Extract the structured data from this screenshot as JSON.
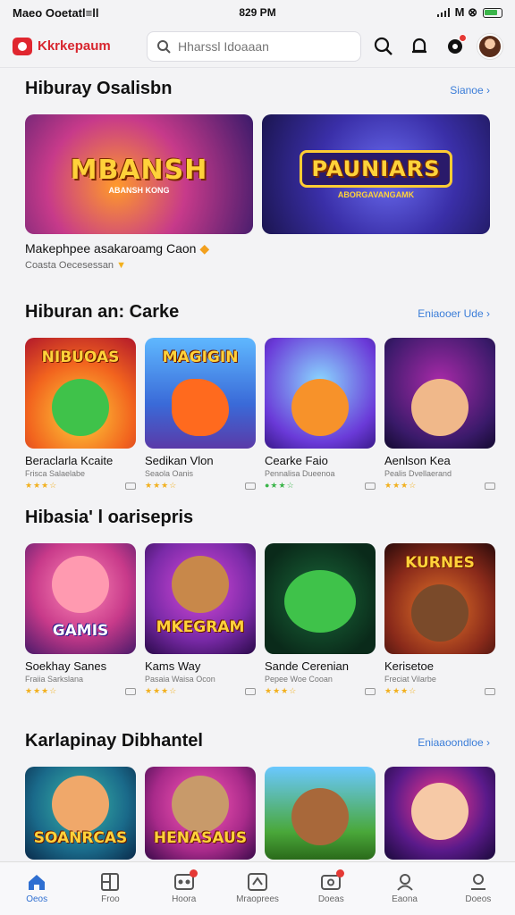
{
  "status_bar": {
    "carrier": "Maeo Ooetatl≡ll",
    "time": "829 PM",
    "right_text": "M ⊗"
  },
  "app_bar": {
    "brand": "Kkrkepaum",
    "search_placeholder": "Hharssl Idoaaan"
  },
  "sections": [
    {
      "title": "Hiburay Osalisbn",
      "link": "Sianoe",
      "featured": [
        {
          "banner": "MBANSH",
          "sub": "ABANSH KONG"
        },
        {
          "banner": "PAUNIARS",
          "sub": "ABORGAVANGAMK"
        }
      ],
      "caption": "Makephpee asakaroamg Caon",
      "caption_sub": "Coasta Oecesessan"
    },
    {
      "title": "Hiburan an: Carke",
      "link": "Eniaooer Ude",
      "tiles": [
        {
          "word": "NIBUOAS",
          "name": "Beraclarla Kcaite",
          "sub": "Frisca Salaelabe",
          "rating": "★★★☆"
        },
        {
          "word": "MAGIGIN",
          "name": "Sedikan Vlon",
          "sub": "Seaola Oanis",
          "rating": "★★★☆"
        },
        {
          "word": "",
          "name": "Cearke Faio",
          "sub": "Pennalisa Dueenoa",
          "rating": "●★★☆"
        },
        {
          "word": "",
          "name": "Aenlson Kea",
          "sub": "Pealis Dvellaerand",
          "rating": "★★★☆"
        }
      ]
    },
    {
      "title": "Hibasia' l oarisepris",
      "link": "",
      "tiles": [
        {
          "word": "GAMIS",
          "name": "Soekhay Sanes",
          "sub": "Fraiia Sarkslana",
          "rating": "★★★☆"
        },
        {
          "word": "MKEGRAM",
          "name": "Kams Way",
          "sub": "Pasaia Waisa Ocon",
          "rating": "★★★☆"
        },
        {
          "word": "",
          "name": "Sande Cerenian",
          "sub": "Pepee Woe Cooan",
          "rating": "★★★☆"
        },
        {
          "word": "KURNES",
          "name": "Kerisetoe",
          "sub": "Freciat Vilarbe",
          "rating": "★★★☆"
        }
      ]
    },
    {
      "title": "Karlapinay Dibhantel",
      "link": "Eniaaoondloe",
      "tiles": [
        {
          "word": "SOANRCAS",
          "name": "",
          "sub": "",
          "rating": ""
        },
        {
          "word": "HENASAUS",
          "name": "",
          "sub": "",
          "rating": ""
        },
        {
          "word": "",
          "name": "",
          "sub": "",
          "rating": ""
        },
        {
          "word": "",
          "name": "",
          "sub": "",
          "rating": ""
        }
      ]
    }
  ],
  "bottom_nav": [
    {
      "label": "Oeos",
      "icon": "home-icon"
    },
    {
      "label": "Froo",
      "icon": "grid-icon"
    },
    {
      "label": "Hoora",
      "icon": "games-icon"
    },
    {
      "label": "Mraoprees",
      "icon": "apps-icon"
    },
    {
      "label": "Doeas",
      "icon": "library-icon"
    },
    {
      "label": "Eaona",
      "icon": "people-icon"
    },
    {
      "label": "Doeos",
      "icon": "profile-icon"
    }
  ]
}
